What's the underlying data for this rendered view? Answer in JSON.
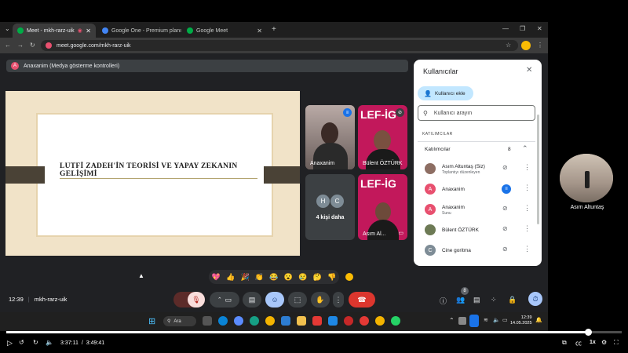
{
  "browser": {
    "tabs": [
      {
        "label": "Meet - mkh-rarz-uik",
        "active": true
      },
      {
        "label": "Google One - Premium planı",
        "active": false
      },
      {
        "label": "Google Meet",
        "active": false
      }
    ],
    "url": "meet.google.com/mkh-rarz-uik"
  },
  "meet": {
    "presenting_badge": "A",
    "presenting_text": "Anaxanim (Medya gösterme kontrolleri)",
    "slide_title": "LUTFİ ZADEH'İN TEORİSİ VE YAPAY ZEKANIN GELİŞİMİ",
    "tiles": {
      "tile1_name": "Anaxanim",
      "tile2_name": "Bülent ÖZTÜRK",
      "tile3_label": "4 kişi daha",
      "tile3_avatars": [
        "H",
        "C"
      ],
      "tile4_name": "Asım Al...",
      "lef_text": "LEF-İG"
    },
    "reactions": [
      "💖",
      "👍",
      "🎉",
      "👏",
      "😂",
      "😮",
      "😢",
      "🤔",
      "👎"
    ],
    "time": "12:39",
    "meeting_code": "mkh-rarz-uik",
    "people_count_badge": "8"
  },
  "panel": {
    "title": "Kullanıcılar",
    "add_button": "Kullanıcı ekle",
    "search_placeholder": "Kullanıcı arayın",
    "section_label": "KATILIMCILAR",
    "group_label": "Katılımcılar",
    "group_count": "8",
    "people": [
      {
        "name": "Asım Altuntaş (Siz)",
        "sub": "Toplantıyı düzenleyen",
        "initial": "",
        "color": "#8d6e63"
      },
      {
        "name": "Anaxanim",
        "sub": "",
        "initial": "A",
        "color": "#e8506f"
      },
      {
        "name": "Anaxanim",
        "sub": "Sunu",
        "initial": "A",
        "color": "#e8506f"
      },
      {
        "name": "Bülent ÖZTÜRK",
        "sub": "",
        "initial": "",
        "color": "#6d7a55"
      },
      {
        "name": "Cine goritma",
        "sub": "",
        "initial": "C",
        "color": "#7e8c96"
      }
    ]
  },
  "side_video": {
    "name": "Asım Altuntaş"
  },
  "taskbar": {
    "search_label": "Ara",
    "clock_time": "12:39",
    "clock_date": "14.05.2025"
  },
  "player": {
    "current": "3:37:11",
    "total": "3:49:41",
    "speed": "1x",
    "progress_fraction": 0.9456
  }
}
